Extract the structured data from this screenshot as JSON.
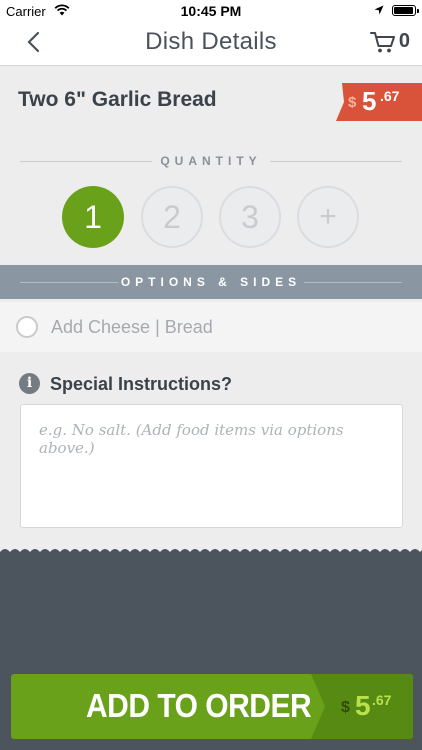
{
  "status_bar": {
    "carrier": "Carrier",
    "time": "10:45 PM"
  },
  "nav": {
    "title": "Dish Details",
    "cart_count": "0"
  },
  "dish": {
    "name": "Two 6\" Garlic Bread",
    "price_currency": "$",
    "price_whole": "5",
    "price_cents": ".67"
  },
  "quantity": {
    "label": "QUANTITY",
    "options": [
      "1",
      "2",
      "3",
      "+"
    ],
    "selected": "1"
  },
  "options": {
    "label": "OPTIONS & SIDES",
    "items": [
      {
        "label": "Add Cheese | Bread",
        "checked": false
      }
    ]
  },
  "instructions": {
    "title": "Special Instructions?",
    "placeholder": "e.g. No salt. (Add food items via options above.)",
    "value": ""
  },
  "add_to_order": {
    "label": "ADD TO ORDER",
    "price_currency": "$",
    "price_whole": "5",
    "price_cents": ".67"
  },
  "colors": {
    "accent_green": "#6aa11b",
    "price_red": "#d9533a",
    "nav_text": "#4a525b",
    "dark_bg": "#4c545d",
    "options_bar": "#8a97a2"
  }
}
